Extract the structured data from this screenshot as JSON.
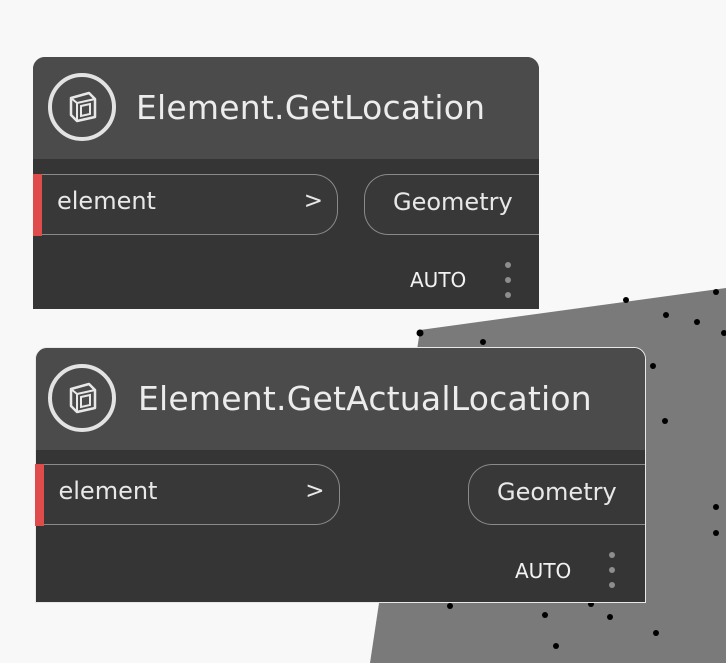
{
  "colors": {
    "canvas_background": "#f8f8f8",
    "node_body": "#353535",
    "node_header": "#4b4b4b",
    "port_indicator": "#e04b4b",
    "geometry_preview": "#7a7a7a"
  },
  "nodes": [
    {
      "icon": "revit-element-icon",
      "title": "Element.GetLocation",
      "input_port": {
        "label": "element",
        "arrow": ">"
      },
      "output_port": {
        "label": "Geometry"
      },
      "lacing": "AUTO",
      "selected": false
    },
    {
      "icon": "revit-element-icon",
      "title": "Element.GetActualLocation",
      "input_port": {
        "label": "element",
        "arrow": ">"
      },
      "output_port": {
        "label": "Geometry"
      },
      "lacing": "AUTO",
      "selected": true
    }
  ]
}
